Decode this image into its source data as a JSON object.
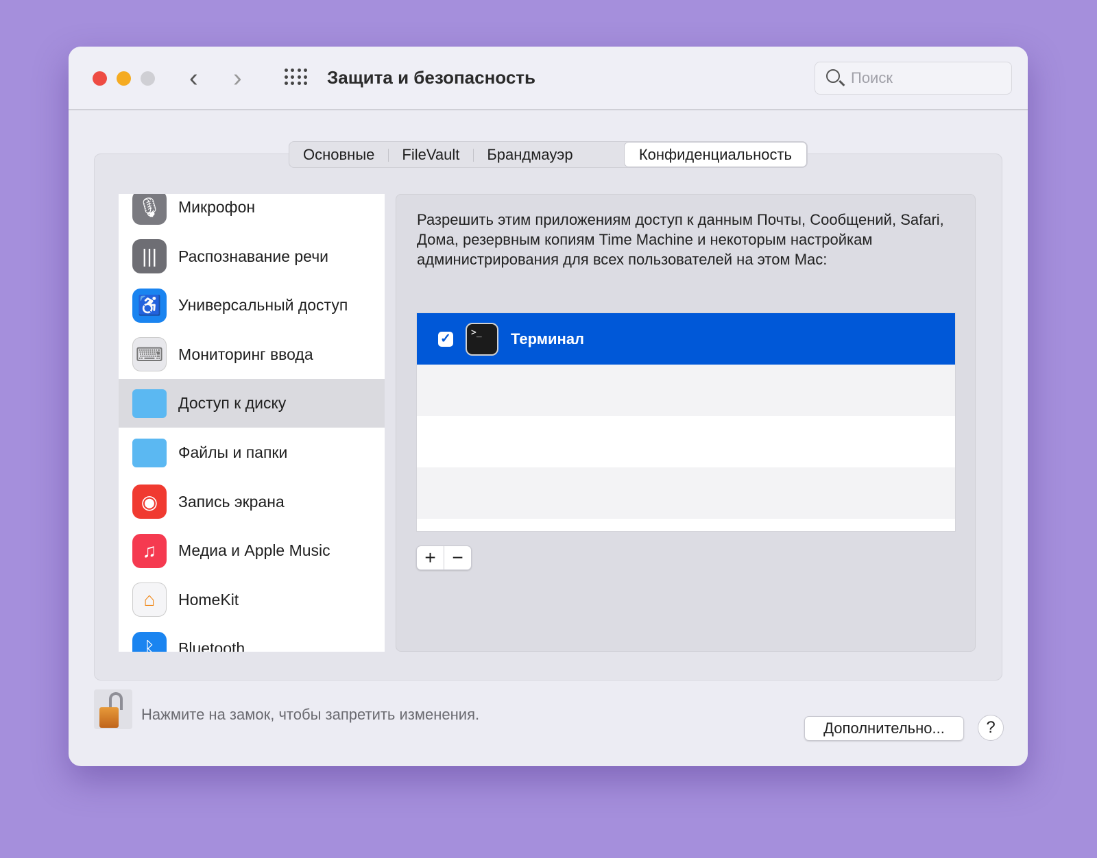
{
  "window": {
    "title": "Защита и безопасность",
    "search_placeholder": "Поиск"
  },
  "tabs": [
    "Основные",
    "FileVault",
    "Брандмауэр",
    "Конфиденциальность"
  ],
  "active_tab": "Конфиденциальность",
  "sidebar": {
    "items": [
      {
        "label": "Микрофон",
        "icon": "microphone-icon",
        "color": "#7a7a80"
      },
      {
        "label": "Распознавание речи",
        "icon": "speech-recognition-icon",
        "color": "#6e6e74"
      },
      {
        "label": "Универсальный доступ",
        "icon": "accessibility-icon",
        "color": "#1a84f0"
      },
      {
        "label": "Мониторинг ввода",
        "icon": "keyboard-icon",
        "color": "#e8e8ec"
      },
      {
        "label": "Доступ к диску",
        "icon": "folder-icon",
        "color": "#5bb8f2",
        "selected": true
      },
      {
        "label": "Файлы и папки",
        "icon": "folder-icon",
        "color": "#5bb8f2"
      },
      {
        "label": "Запись экрана",
        "icon": "screen-recording-icon",
        "color": "#f03a30"
      },
      {
        "label": "Медиа и Apple Music",
        "icon": "music-icon",
        "color": "#f53a50"
      },
      {
        "label": "HomeKit",
        "icon": "home-icon",
        "color": "#f5f5f7"
      },
      {
        "label": "Bluetooth",
        "icon": "bluetooth-icon",
        "color": "#1a84f0"
      }
    ]
  },
  "panel": {
    "description": "Разрешить этим приложениям доступ к данным Почты, Сообщений, Safari, Дома, резервным копиям Time Machine и некоторым настройкам администрирования для всех пользователей на этом Mac:",
    "apps": [
      {
        "name": "Терминал",
        "checked": true,
        "icon_text": ">_"
      }
    ],
    "add_label": "+",
    "remove_label": "−"
  },
  "footer": {
    "lock_hint": "Нажмите на замок, чтобы запретить изменения.",
    "advanced_label": "Дополнительно...",
    "help_label": "?"
  }
}
